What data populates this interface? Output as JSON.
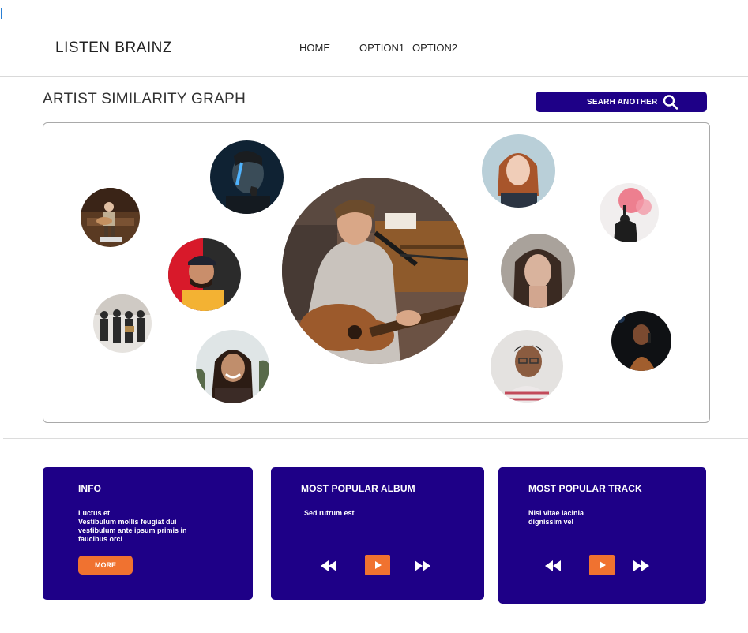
{
  "header": {
    "brand": "LISTEN BRAINZ",
    "nav": [
      "HOME",
      "OPTION1",
      "OPTION2"
    ]
  },
  "page": {
    "title": "ARTIST SIMILARITY GRAPH",
    "search_button": "SEARH ANOTHER",
    "search_icon": "search-icon"
  },
  "graph": {
    "center_artist": "artist-photo-guitar-singer",
    "nodes": [
      "artist-photo-guitarist-stage",
      "artist-photo-man-blue-light",
      "artist-photo-man-cap",
      "artist-photo-band",
      "artist-photo-woman-smiling",
      "artist-photo-woman-redhead",
      "artist-photo-red-smoke",
      "artist-photo-woman-portrait",
      "artist-photo-man-glasses",
      "artist-photo-singer-mic"
    ]
  },
  "cards": {
    "info": {
      "title": "INFO",
      "lines": [
        "Luctus et",
        "Vestibulum mollis feugiat dui",
        "vestibulum ante ipsum primis in",
        "faucibus orci"
      ],
      "button": "MORE"
    },
    "album": {
      "title": "MOST POPULAR ALBUM",
      "text": "Sed rutrum est"
    },
    "track": {
      "title": "MOST POPULAR TRACK",
      "lines": [
        "Nisi vitae lacinia",
        "dignissim vel"
      ]
    }
  },
  "colors": {
    "accent": "#1e0087",
    "button": "#f07230"
  }
}
